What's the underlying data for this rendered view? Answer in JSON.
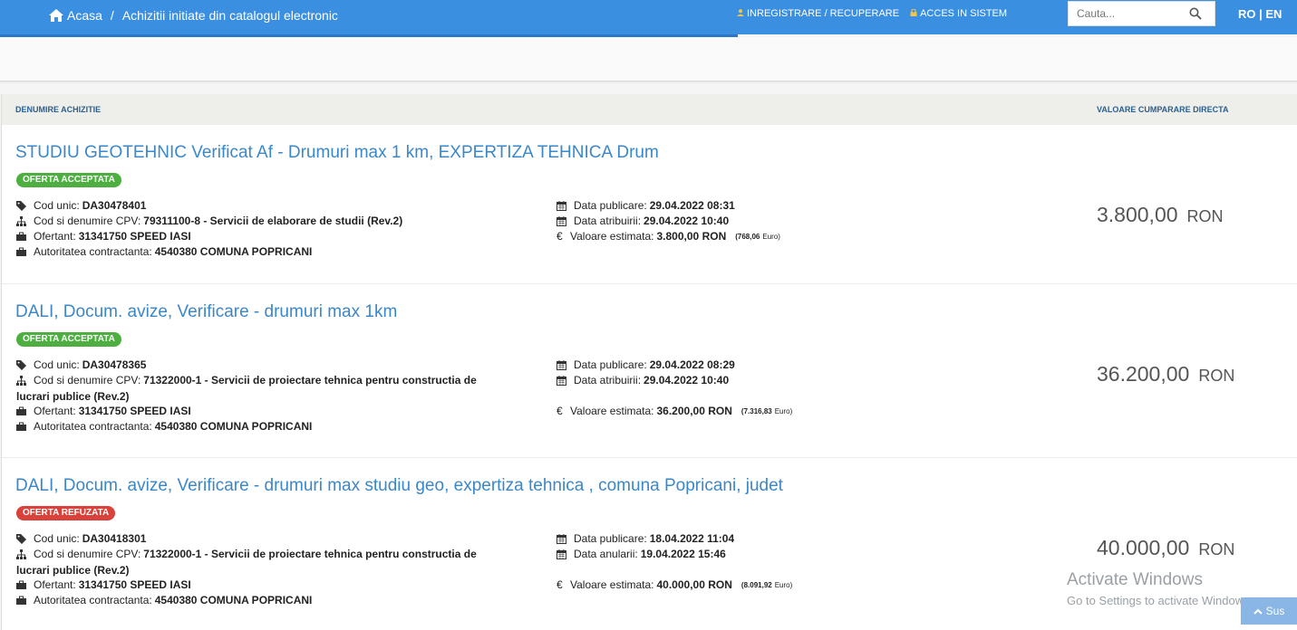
{
  "header": {
    "home_label": "Acasa",
    "breadcrumb_sep": "/",
    "breadcrumb_current": "Achizitii initiate din catalogul electronic",
    "register_label": "INREGISTRARE / RECUPERARE",
    "login_label": "ACCES IN SISTEM",
    "search_placeholder": "Cauta...",
    "lang": "RO | EN"
  },
  "table": {
    "col_name": "DENUMIRE ACHIZITIE",
    "col_value": "VALOARE CUMPARARE DIRECTA"
  },
  "labels": {
    "cod_unic": "Cod unic:",
    "cpv": "Cod si denumire CPV:",
    "ofertant": "Ofertant:",
    "autoritate": "Autoritatea contractanta:",
    "data_publicare": "Data publicare:",
    "data_atribuirii": "Data atribuirii:",
    "data_anularii": "Data anularii:",
    "valoare_estimata": "Valoare estimata:",
    "euro_sign": "€",
    "euro_word": "Euro",
    "currency": "RON"
  },
  "items": [
    {
      "title": "STUDIU GEOTEHNIC Verificat Af - Drumuri max 1 km, EXPERTIZA TEHNICA Drum",
      "status": "OFERTA ACCEPTATA",
      "status_color": "#4caf3f",
      "cod_unic": "DA30478401",
      "cpv_line1": "79311100-8 - Servicii de elaborare de studii (Rev.2)",
      "cpv_line2": "",
      "ofertant": "31341750 SPEED IASI",
      "autoritate": "4540380 COMUNA POPRICANI",
      "data_publicare": "29.04.2022 08:31",
      "data_doua": "29.04.2022 10:40",
      "valoare_estimata": "3.800,00",
      "valoare_euro": "(768,06",
      "euro_close": "Euro)",
      "price": "3.800,00"
    },
    {
      "title": "DALI, Docum. avize, Verificare - drumuri max 1km",
      "status": "OFERTA ACCEPTATA",
      "status_color": "#4caf3f",
      "cod_unic": "DA30478365",
      "cpv_line1": "71322000-1 - Servicii de proiectare tehnica pentru constructia de",
      "cpv_line2": "lucrari publice (Rev.2)",
      "ofertant": "31341750 SPEED IASI",
      "autoritate": "4540380 COMUNA POPRICANI",
      "data_publicare": "29.04.2022 08:29",
      "data_doua": "29.04.2022 10:40",
      "valoare_estimata": "36.200,00",
      "valoare_euro": "(7.316,83",
      "euro_close": "Euro)",
      "price": "36.200,00"
    },
    {
      "title": "DALI, Docum. avize, Verificare - drumuri max studiu geo, expertiza tehnica , comuna Popricani, judet",
      "status": "OFERTA REFUZATA",
      "status_color": "#d9413a",
      "cod_unic": "DA30418301",
      "cpv_line1": "71322000-1 - Servicii de proiectare tehnica pentru constructia de",
      "cpv_line2": "lucrari publice (Rev.2)",
      "ofertant": "31341750 SPEED IASI",
      "autoritate": "4540380 COMUNA POPRICANI",
      "data_publicare": "18.04.2022 11:04",
      "data_doua": "19.04.2022 15:46",
      "valoare_estimata": "40.000,00",
      "valoare_euro": "(8.091,92",
      "euro_close": "Euro)",
      "price": "40.000,00"
    }
  ],
  "watermark": {
    "line1": "Activate Windows",
    "line2": "Go to Settings to activate Windows."
  },
  "scroll_top": "Sus"
}
